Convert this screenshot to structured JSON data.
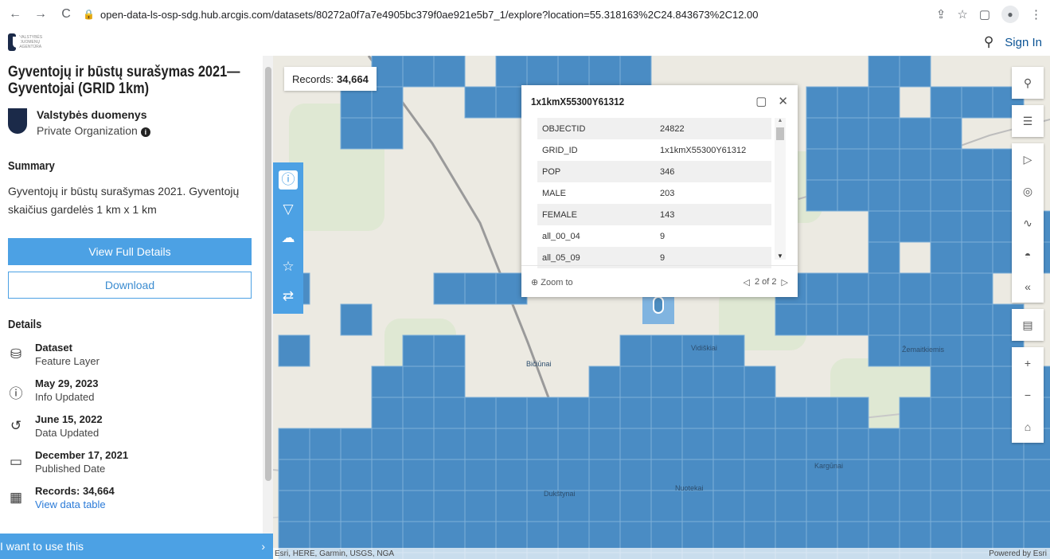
{
  "browser": {
    "url": "open-data-ls-osp-sdg.hub.arcgis.com/datasets/80272a0f7a7e4905bc379f0ae921e5b7_1/explore?location=55.318163%2C24.843673%2C12.00",
    "back_icon": "←",
    "forward_icon": "→",
    "reload_icon": "C"
  },
  "header": {
    "logo_text": "VALSTYBĖS DUOMENŲ AGENTŪRA",
    "sign_in": "Sign In"
  },
  "dataset": {
    "title": "Gyventojų ir būstų surašymas 2021—Gyventojai (GRID 1km)",
    "owner_name": "Valstybės duomenys",
    "owner_type": "Private Organization",
    "summary_heading": "Summary",
    "summary": "Gyventojų ir būstų surašymas 2021. Gyventojų skaičius gardelės 1 km x 1 km",
    "view_full_details": "View Full Details",
    "download": "Download",
    "details_heading": "Details",
    "details": [
      {
        "main": "Dataset",
        "sub": "Feature Layer",
        "icon": "database-icon"
      },
      {
        "main": "May 29, 2023",
        "sub": "Info Updated",
        "icon": "info-icon"
      },
      {
        "main": "June 15, 2022",
        "sub": "Data Updated",
        "icon": "history-icon"
      },
      {
        "main": "December 17, 2021",
        "sub": "Published Date",
        "icon": "calendar-icon"
      },
      {
        "main": "Records: 34,664",
        "sub": "View data table",
        "icon": "table-icon"
      }
    ],
    "want_to_use": "I want to use this"
  },
  "map": {
    "records_label": "Records:",
    "records_value": "34,664",
    "attribution": "Esri, HERE, Garmin, USGS, NGA",
    "powered_by": "Powered by Esri",
    "place_labels": [
      {
        "text": "Vidiškiai"
      },
      {
        "text": "Bičiūnai"
      },
      {
        "text": "Žemaitkiemis"
      },
      {
        "text": "Dukštynai"
      },
      {
        "text": "Nuotekai"
      },
      {
        "text": "Kargūnai"
      }
    ],
    "fill_color": "#4a8cc4",
    "grid_line_color": "#7fb0d8"
  },
  "popup": {
    "title": "1x1kmX55300Y61312",
    "rows": [
      {
        "key": "OBJECTID",
        "value": "24822"
      },
      {
        "key": "GRID_ID",
        "value": "1x1kmX55300Y61312"
      },
      {
        "key": "POP",
        "value": "346"
      },
      {
        "key": "MALE",
        "value": "203"
      },
      {
        "key": "FEMALE",
        "value": "143"
      },
      {
        "key": "all_00_04",
        "value": "9"
      },
      {
        "key": "all_05_09",
        "value": "9"
      }
    ],
    "zoom_to": "Zoom to",
    "pager": "2 of 2"
  }
}
